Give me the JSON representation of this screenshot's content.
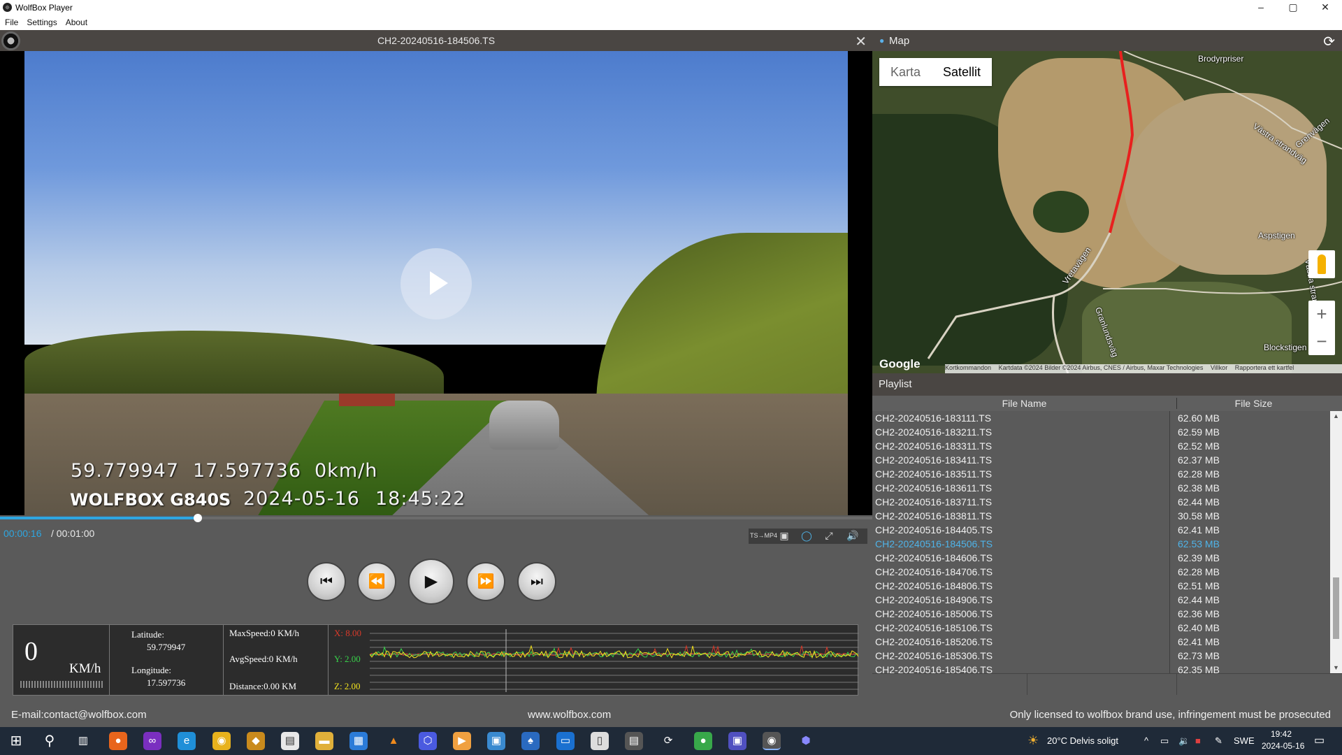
{
  "window": {
    "title": "WolfBox Player",
    "controls": [
      "–",
      "▢",
      "✕"
    ]
  },
  "menu": [
    "File",
    "Settings",
    "About"
  ],
  "video": {
    "filename": "CH2-20240516-184506.TS",
    "overlay": {
      "lat": "59.779947",
      "lon": "17.597736",
      "speed": "0km/h",
      "brand": "WOLFBOX G840S",
      "date": "2024-05-16",
      "time": "18:45:22"
    },
    "progress_fraction": 0.227,
    "current_time": "00:00:16",
    "total_time": "/ 00:01:00"
  },
  "tools": [
    "TS→MP4",
    "▣",
    "◯",
    "⤢",
    "🔊"
  ],
  "telemetry": {
    "speed": "0",
    "speed_unit": "KM/h",
    "latitude_label": "Latitude:",
    "latitude": "59.779947",
    "longitude_label": "Longitude:",
    "longitude": "17.597736",
    "max_speed": "MaxSpeed:0 KM/h",
    "avg_speed": "AvgSpeed:0 KM/h",
    "distance": "Distance:0.00 KM",
    "x_axis": "X: 8.00",
    "y_axis": "Y: 2.00",
    "z_axis": "Z: 2.00",
    "colors": {
      "x": "#d83a2a",
      "y": "#38d24a",
      "z": "#f2e21e"
    }
  },
  "footer": {
    "email": "E-mail:contact@wolfbox.com",
    "website": "www.wolfbox.com",
    "notice": "Only licensed to wolfbox brand use, infringement must be prosecuted"
  },
  "map": {
    "title": "Map",
    "tabs": [
      "Karta",
      "Satellit"
    ],
    "selected_tab": "Satellit",
    "google": "Google",
    "attribution": [
      "Kortkommandon",
      "Kartdata ©2024 Bilder ©2024 Airbus, CNES / Airbus, Maxar Technologies",
      "Villkor",
      "Rapportera ett kartfel"
    ],
    "places": [
      "Brodyrpriser",
      "Västra strandväg",
      "Grenvägen",
      "Aspstigen",
      "Vretavägen",
      "Västra strandv.",
      "Blockstigen",
      "Granlundsväg"
    ]
  },
  "playlist": {
    "title": "Playlist",
    "col_name": "File Name",
    "col_size": "File Size",
    "selected_index": 9,
    "rows": [
      {
        "name": "CH2-20240516-183111.TS",
        "size": "62.60 MB"
      },
      {
        "name": "CH2-20240516-183211.TS",
        "size": "62.59 MB"
      },
      {
        "name": "CH2-20240516-183311.TS",
        "size": "62.52 MB"
      },
      {
        "name": "CH2-20240516-183411.TS",
        "size": "62.37 MB"
      },
      {
        "name": "CH2-20240516-183511.TS",
        "size": "62.28 MB"
      },
      {
        "name": "CH2-20240516-183611.TS",
        "size": "62.38 MB"
      },
      {
        "name": "CH2-20240516-183711.TS",
        "size": "62.44 MB"
      },
      {
        "name": "CH2-20240516-183811.TS",
        "size": "30.58 MB"
      },
      {
        "name": "CH2-20240516-184405.TS",
        "size": "62.41 MB"
      },
      {
        "name": "CH2-20240516-184506.TS",
        "size": "62.53 MB"
      },
      {
        "name": "CH2-20240516-184606.TS",
        "size": "62.39 MB"
      },
      {
        "name": "CH2-20240516-184706.TS",
        "size": "62.28 MB"
      },
      {
        "name": "CH2-20240516-184806.TS",
        "size": "62.51 MB"
      },
      {
        "name": "CH2-20240516-184906.TS",
        "size": "62.44 MB"
      },
      {
        "name": "CH2-20240516-185006.TS",
        "size": "62.36 MB"
      },
      {
        "name": "CH2-20240516-185106.TS",
        "size": "62.40 MB"
      },
      {
        "name": "CH2-20240516-185206.TS",
        "size": "62.41 MB"
      },
      {
        "name": "CH2-20240516-185306.TS",
        "size": "62.73 MB"
      },
      {
        "name": "CH2-20240516-185406.TS",
        "size": "62.35 MB"
      }
    ]
  },
  "taskbar": {
    "weather": "20°C  Delvis soligt",
    "language": "SWE",
    "time": "19:42",
    "date": "2024-05-16"
  }
}
